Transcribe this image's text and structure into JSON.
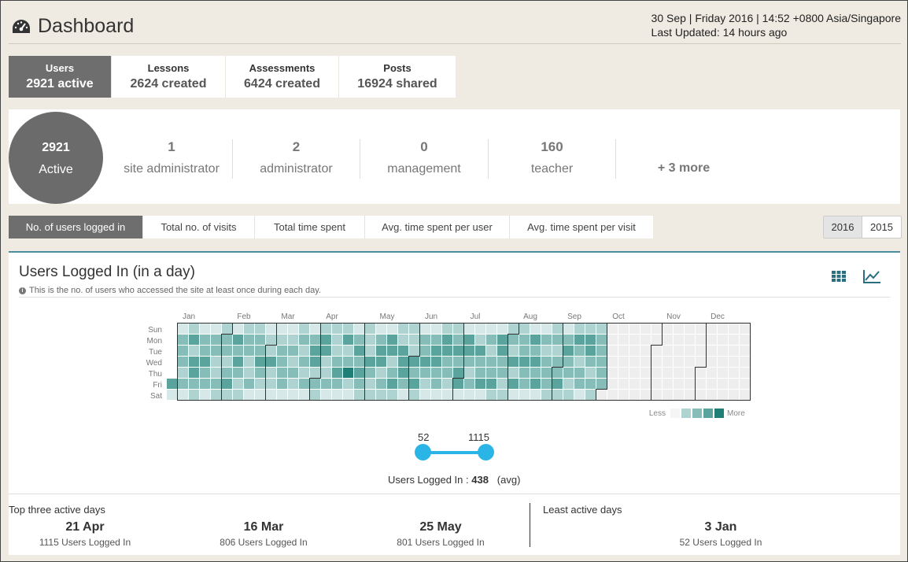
{
  "header": {
    "title": "Dashboard",
    "date_line": "30 Sep | Friday 2016 | 14:52 +0800 Asia/Singapore",
    "updated_line": "Last Updated: 14 hours ago"
  },
  "stat_tabs": [
    {
      "label": "Users",
      "value": "2921 active"
    },
    {
      "label": "Lessons",
      "value": "2624 created"
    },
    {
      "label": "Assessments",
      "value": "6424 created"
    },
    {
      "label": "Posts",
      "value": "16924 shared"
    }
  ],
  "active_users": {
    "count": "2921",
    "label": "Active"
  },
  "roles": [
    {
      "count": "1",
      "label": "site administrator"
    },
    {
      "count": "2",
      "label": "administrator"
    },
    {
      "count": "0",
      "label": "management"
    },
    {
      "count": "160",
      "label": "teacher"
    },
    {
      "count": "",
      "label": "+ 3 more"
    }
  ],
  "metric_tabs": [
    "No. of users logged in",
    "Total no. of visits",
    "Total time spent",
    "Avg. time spent per user",
    "Avg. time spent per visit"
  ],
  "years": [
    "2016",
    "2015"
  ],
  "panel": {
    "title": "Users Logged In (in a day)",
    "subtitle": "This is the no. of users who accessed the site at least once during each day.",
    "info_icon": "i",
    "grid_icon": "grid-icon",
    "line_chart_icon": "line-chart-icon"
  },
  "chart_data": {
    "type": "heatmap",
    "year": 2016,
    "months": [
      "Jan",
      "Feb",
      "Mar",
      "Apr",
      "May",
      "Jun",
      "Jul",
      "Aug",
      "Sep",
      "Oct",
      "Nov",
      "Dec"
    ],
    "weekdays": [
      "Sun",
      "Mon",
      "Tue",
      "Wed",
      "Thu",
      "Fri",
      "Sat"
    ],
    "legend_less": "Less",
    "legend_more": "More",
    "color_scale": [
      "#eeeeee",
      "#d6e8e7",
      "#aed3d0",
      "#86bdb8",
      "#5ba39d",
      "#1f7f76"
    ],
    "data_through": "2016-09-30"
  },
  "slider": {
    "min": "52",
    "max": "1115"
  },
  "avg": {
    "label": "Users Logged In :",
    "value": "438",
    "suffix": "(avg)"
  },
  "top_days": {
    "label": "Top three active days",
    "items": [
      {
        "date": "21 Apr",
        "count": "1115 Users Logged In"
      },
      {
        "date": "16 Mar",
        "count": "806 Users Logged In"
      },
      {
        "date": "25 May",
        "count": "801 Users Logged In"
      }
    ]
  },
  "least_days": {
    "label": "Least active days",
    "items": [
      {
        "date": "3 Jan",
        "count": "52 Users Logged In"
      }
    ]
  }
}
